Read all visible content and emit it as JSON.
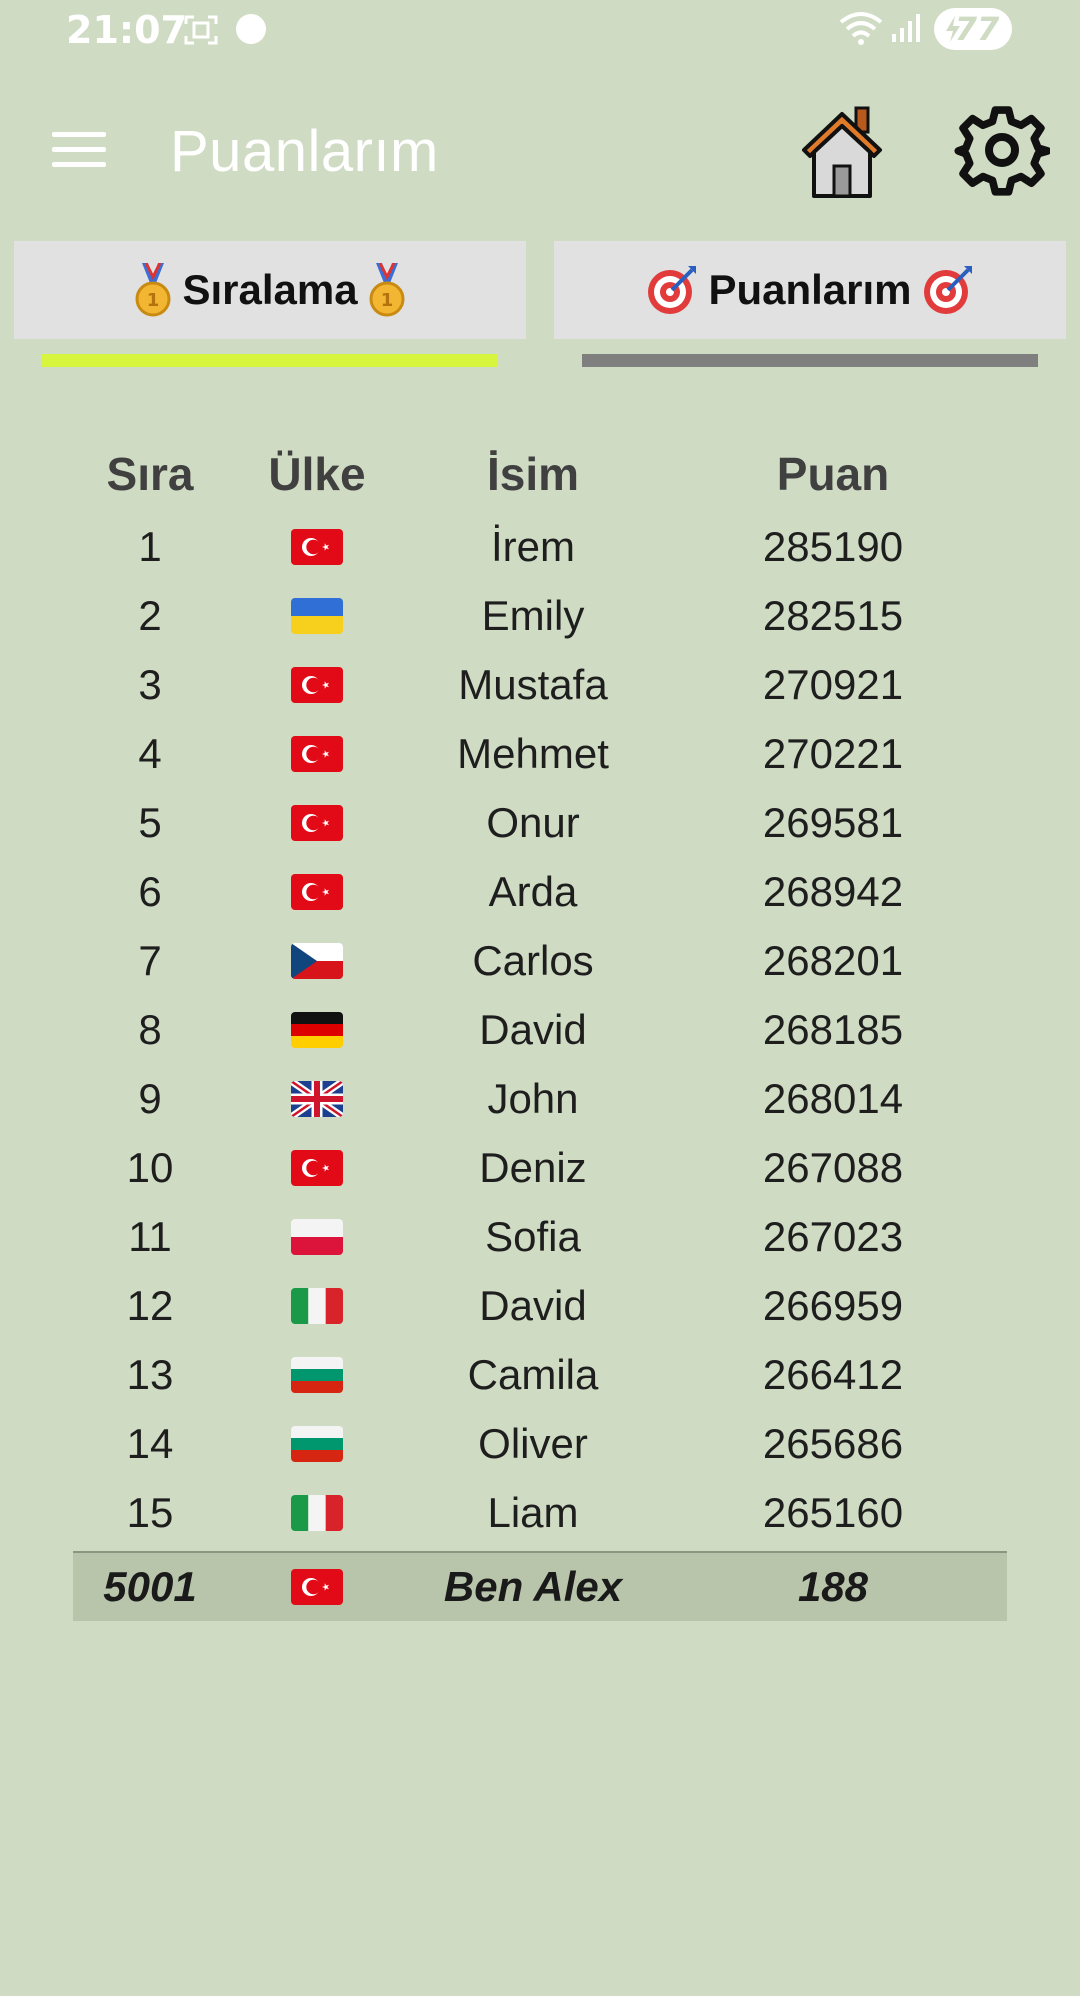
{
  "status_bar": {
    "time": "21:07",
    "battery": "77"
  },
  "app_bar": {
    "title": "Puanlarım"
  },
  "tabs": [
    {
      "label": "Sıralama",
      "icon": "medal-icon",
      "selected": true,
      "indicator_color": "#d6f53c"
    },
    {
      "label": "Puanlarım",
      "icon": "target-icon",
      "selected": false,
      "indicator_color": "#7f7f7f"
    }
  ],
  "table": {
    "headers": {
      "rank": "Sıra",
      "country": "Ülke",
      "name": "İsim",
      "score": "Puan"
    },
    "rows": [
      {
        "rank": "1",
        "flag": "turkey-flag",
        "name": "İrem",
        "score": "285190"
      },
      {
        "rank": "2",
        "flag": "ukraine-flag",
        "name": "Emily",
        "score": "282515"
      },
      {
        "rank": "3",
        "flag": "turkey-flag",
        "name": "Mustafa",
        "score": "270921"
      },
      {
        "rank": "4",
        "flag": "turkey-flag",
        "name": "Mehmet",
        "score": "270221"
      },
      {
        "rank": "5",
        "flag": "turkey-flag",
        "name": "Onur",
        "score": "269581"
      },
      {
        "rank": "6",
        "flag": "turkey-flag",
        "name": "Arda",
        "score": "268942"
      },
      {
        "rank": "7",
        "flag": "czech-flag",
        "name": "Carlos",
        "score": "268201"
      },
      {
        "rank": "8",
        "flag": "germany-flag",
        "name": "David",
        "score": "268185"
      },
      {
        "rank": "9",
        "flag": "uk-flag",
        "name": "John",
        "score": "268014"
      },
      {
        "rank": "10",
        "flag": "turkey-flag",
        "name": "Deniz",
        "score": "267088"
      },
      {
        "rank": "11",
        "flag": "poland-flag",
        "name": "Sofia",
        "score": "267023"
      },
      {
        "rank": "12",
        "flag": "italy-flag",
        "name": "David",
        "score": "266959"
      },
      {
        "rank": "13",
        "flag": "bulgaria-flag",
        "name": "Camila",
        "score": "266412"
      },
      {
        "rank": "14",
        "flag": "bulgaria-flag",
        "name": "Oliver",
        "score": "265686"
      },
      {
        "rank": "15",
        "flag": "italy-flag",
        "name": "Liam",
        "score": "265160"
      }
    ],
    "current_user": {
      "rank": "5001",
      "flag": "turkey-flag",
      "name": "Ben Alex",
      "score": "188"
    }
  },
  "colors": {
    "background": "#cfdbc3",
    "tab_background": "#e1e1e1",
    "active_indicator": "#d6f53c",
    "inactive_indicator": "#7f7f7f",
    "current_user_row": "#b8c5ab"
  }
}
